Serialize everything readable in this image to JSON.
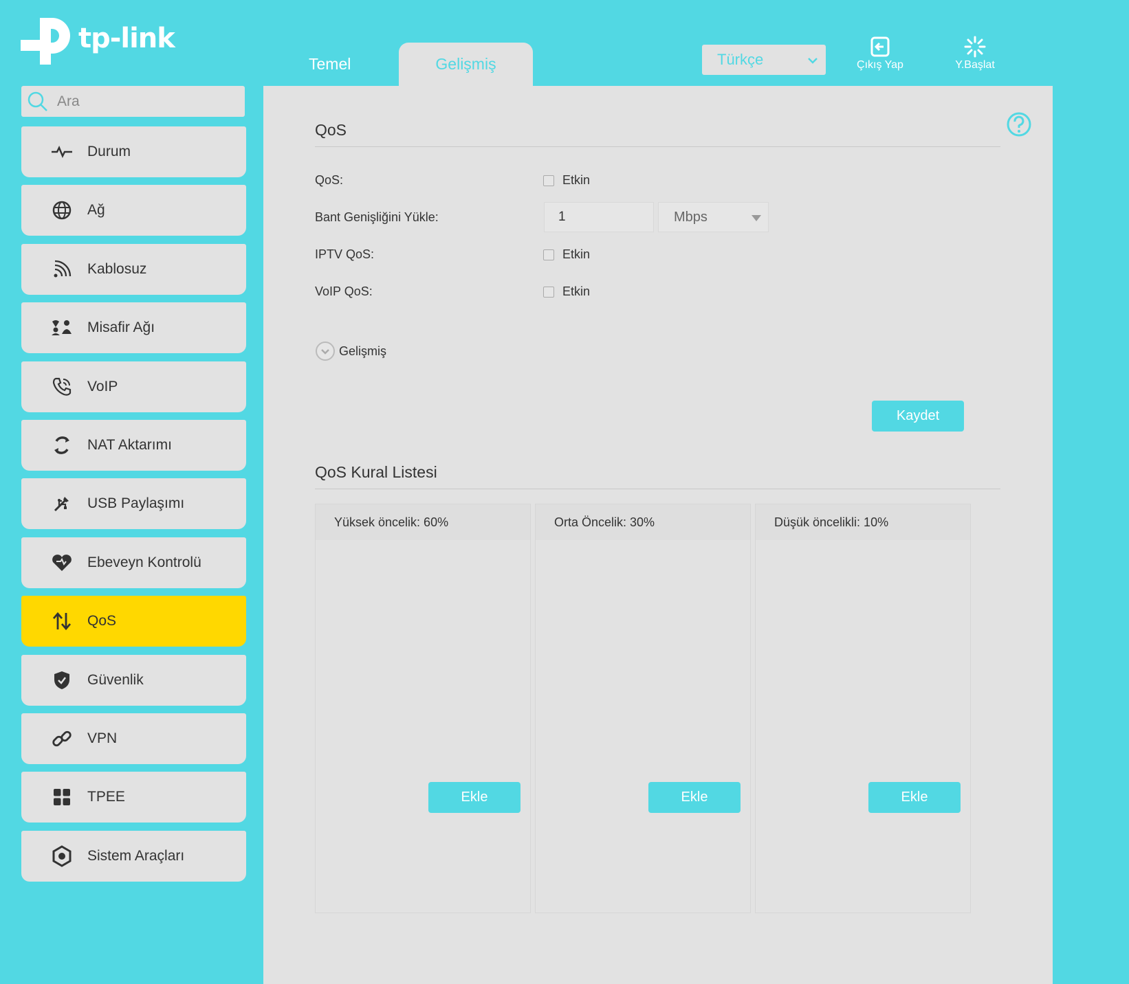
{
  "brand": {
    "name": "tp-link"
  },
  "tabs": {
    "basic": "Temel",
    "advanced": "Gelişmiş"
  },
  "header": {
    "language": "Türkçe",
    "logout": "Çıkış Yap",
    "reboot": "Y.Başlat"
  },
  "search": {
    "placeholder": "Ara"
  },
  "sidebar": {
    "items": [
      {
        "label": "Durum",
        "icon": "pulse-icon"
      },
      {
        "label": "Ağ",
        "icon": "globe-icon"
      },
      {
        "label": "Kablosuz",
        "icon": "wifi-icon"
      },
      {
        "label": "Misafir Ağı",
        "icon": "guests-icon"
      },
      {
        "label": "VoIP",
        "icon": "phone-icon"
      },
      {
        "label": "NAT Aktarımı",
        "icon": "nat-icon"
      },
      {
        "label": "USB Paylaşımı",
        "icon": "usb-icon"
      },
      {
        "label": "Ebeveyn Kontrolü",
        "icon": "heart-icon"
      },
      {
        "label": "QoS",
        "icon": "updown-arrows-icon",
        "active": true
      },
      {
        "label": "Güvenlik",
        "icon": "shield-icon"
      },
      {
        "label": "VPN",
        "icon": "link-icon"
      },
      {
        "label": "TPEE",
        "icon": "grid-icon"
      },
      {
        "label": "Sistem Araçları",
        "icon": "gear-icon"
      }
    ]
  },
  "qos": {
    "title": "QoS",
    "qos_label": "QoS:",
    "bandwidth_label": "Bant Genişliğini Yükle:",
    "bandwidth_value": "1",
    "bandwidth_unit": "Mbps",
    "iptv_label": "IPTV QoS:",
    "voip_label": "VoIP QoS:",
    "enable_label": "Etkin",
    "advanced_label": "Gelişmiş",
    "save_label": "Kaydet"
  },
  "rules": {
    "title": "QoS Kural Listesi",
    "columns": [
      {
        "title": "Yüksek öncelik: 60%",
        "add_label": "Ekle"
      },
      {
        "title": "Orta Öncelik: 30%",
        "add_label": "Ekle"
      },
      {
        "title": "Düşük öncelikli: 10%",
        "add_label": "Ekle"
      }
    ]
  },
  "colors": {
    "accent": "#52d8e3",
    "active": "#ffd800",
    "panel": "#e2e2e2"
  }
}
